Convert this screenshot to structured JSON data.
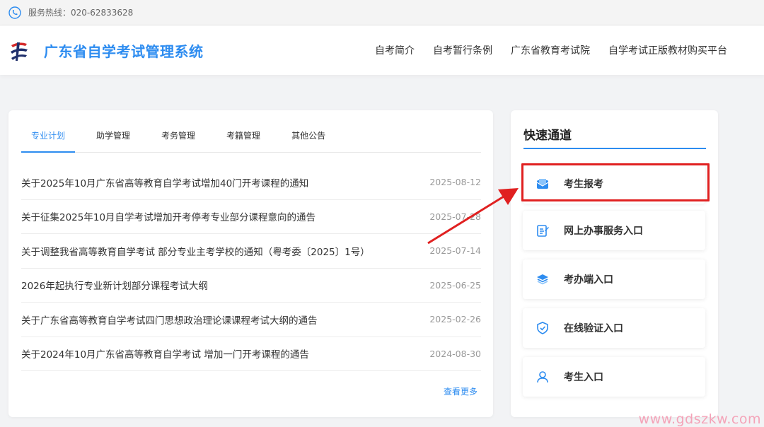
{
  "topbar": {
    "hotline": "服务热线：020-62833628",
    "icon": "phone-icon"
  },
  "header": {
    "title": "广东省自学考试管理系统",
    "nav": [
      "自考简介",
      "自考暂行条例",
      "广东省教育考试院",
      "自学考试正版教材购买平台"
    ]
  },
  "news_panel": {
    "tabs": [
      "专业计划",
      "助学管理",
      "考务管理",
      "考籍管理",
      "其他公告"
    ],
    "active_tab": "专业计划",
    "items": [
      {
        "title": "关于2025年10月广东省高等教育自学考试增加40门开考课程的通知",
        "date": "2025-08-12"
      },
      {
        "title": "关于征集2025年10月自学考试增加开考停考专业部分课程意向的通告",
        "date": "2025-07-28"
      },
      {
        "title": "关于调整我省高等教育自学考试 部分专业主考学校的通知（粤考委〔2025〕1号）",
        "date": "2025-07-14"
      },
      {
        "title": "2026年起执行专业新计划部分课程考试大纲",
        "date": "2025-06-25"
      },
      {
        "title": "关于广东省高等教育自学考试四门思想政治理论课课程考试大纲的通告",
        "date": "2025-02-26"
      },
      {
        "title": "关于2024年10月广东省高等教育自学考试 增加一门开考课程的通告",
        "date": "2024-08-30"
      }
    ],
    "more": "查看更多"
  },
  "quick_panel": {
    "title": "快速通道",
    "items": [
      {
        "label": "考生报考",
        "icon": "envelope-icon"
      },
      {
        "label": "网上办事服务入口",
        "icon": "document-edit-icon"
      },
      {
        "label": "考办端入口",
        "icon": "layers-icon"
      },
      {
        "label": "在线验证入口",
        "icon": "shield-check-icon"
      },
      {
        "label": "考生入口",
        "icon": "user-icon"
      }
    ]
  },
  "colors": {
    "accent": "#2d8cf0",
    "highlight": "#e02020",
    "watermark": "#f4a3b8"
  },
  "watermark": "www.gdszkw.com"
}
